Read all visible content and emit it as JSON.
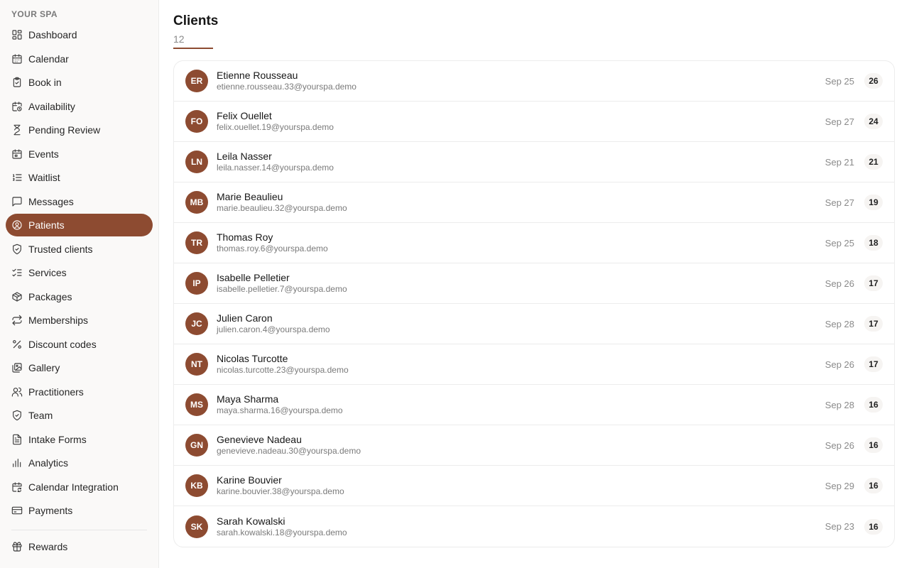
{
  "sidebar": {
    "brand": "YOUR SPA",
    "items": [
      {
        "label": "Dashboard",
        "icon": "dashboard-icon"
      },
      {
        "label": "Calendar",
        "icon": "calendar-icon"
      },
      {
        "label": "Book in",
        "icon": "clipboard-check-icon"
      },
      {
        "label": "Availability",
        "icon": "calendar-clock-icon"
      },
      {
        "label": "Pending Review",
        "icon": "hourglass-icon"
      },
      {
        "label": "Events",
        "icon": "calendar-event-icon"
      },
      {
        "label": "Waitlist",
        "icon": "list-ordered-icon"
      },
      {
        "label": "Messages",
        "icon": "message-icon"
      },
      {
        "label": "Patients",
        "icon": "user-circle-icon",
        "active": true
      },
      {
        "label": "Trusted clients",
        "icon": "shield-check-icon"
      },
      {
        "label": "Services",
        "icon": "list-checks-icon"
      },
      {
        "label": "Packages",
        "icon": "package-icon"
      },
      {
        "label": "Memberships",
        "icon": "repeat-icon"
      },
      {
        "label": "Discount codes",
        "icon": "percent-icon"
      },
      {
        "label": "Gallery",
        "icon": "gallery-icon"
      },
      {
        "label": "Practitioners",
        "icon": "users-icon"
      },
      {
        "label": "Team",
        "icon": "shield-icon"
      },
      {
        "label": "Intake Forms",
        "icon": "file-text-icon"
      },
      {
        "label": "Analytics",
        "icon": "bar-chart-icon"
      },
      {
        "label": "Calendar Integration",
        "icon": "calendar-sync-icon"
      },
      {
        "label": "Payments",
        "icon": "credit-card-icon"
      }
    ],
    "secondary_items": [
      {
        "label": "Rewards",
        "icon": "gift-icon"
      }
    ]
  },
  "main": {
    "title": "Clients",
    "count": "12",
    "clients": [
      {
        "initials": "ER",
        "name": "Etienne Rousseau",
        "email": "etienne.rousseau.33@yourspa.demo",
        "date": "Sep 25",
        "visits": "26"
      },
      {
        "initials": "FO",
        "name": "Felix Ouellet",
        "email": "felix.ouellet.19@yourspa.demo",
        "date": "Sep 27",
        "visits": "24"
      },
      {
        "initials": "LN",
        "name": "Leila Nasser",
        "email": "leila.nasser.14@yourspa.demo",
        "date": "Sep 21",
        "visits": "21"
      },
      {
        "initials": "MB",
        "name": "Marie Beaulieu",
        "email": "marie.beaulieu.32@yourspa.demo",
        "date": "Sep 27",
        "visits": "19"
      },
      {
        "initials": "TR",
        "name": "Thomas Roy",
        "email": "thomas.roy.6@yourspa.demo",
        "date": "Sep 25",
        "visits": "18"
      },
      {
        "initials": "IP",
        "name": "Isabelle Pelletier",
        "email": "isabelle.pelletier.7@yourspa.demo",
        "date": "Sep 26",
        "visits": "17"
      },
      {
        "initials": "JC",
        "name": "Julien Caron",
        "email": "julien.caron.4@yourspa.demo",
        "date": "Sep 28",
        "visits": "17"
      },
      {
        "initials": "NT",
        "name": "Nicolas Turcotte",
        "email": "nicolas.turcotte.23@yourspa.demo",
        "date": "Sep 26",
        "visits": "17"
      },
      {
        "initials": "MS",
        "name": "Maya Sharma",
        "email": "maya.sharma.16@yourspa.demo",
        "date": "Sep 28",
        "visits": "16"
      },
      {
        "initials": "GN",
        "name": "Genevieve Nadeau",
        "email": "genevieve.nadeau.30@yourspa.demo",
        "date": "Sep 26",
        "visits": "16"
      },
      {
        "initials": "KB",
        "name": "Karine Bouvier",
        "email": "karine.bouvier.38@yourspa.demo",
        "date": "Sep 29",
        "visits": "16"
      },
      {
        "initials": "SK",
        "name": "Sarah Kowalski",
        "email": "sarah.kowalski.18@yourspa.demo",
        "date": "Sep 23",
        "visits": "16"
      }
    ]
  },
  "colors": {
    "accent": "#8d4b31",
    "sidebar_bg": "#faf9f8",
    "border": "#ececec"
  }
}
